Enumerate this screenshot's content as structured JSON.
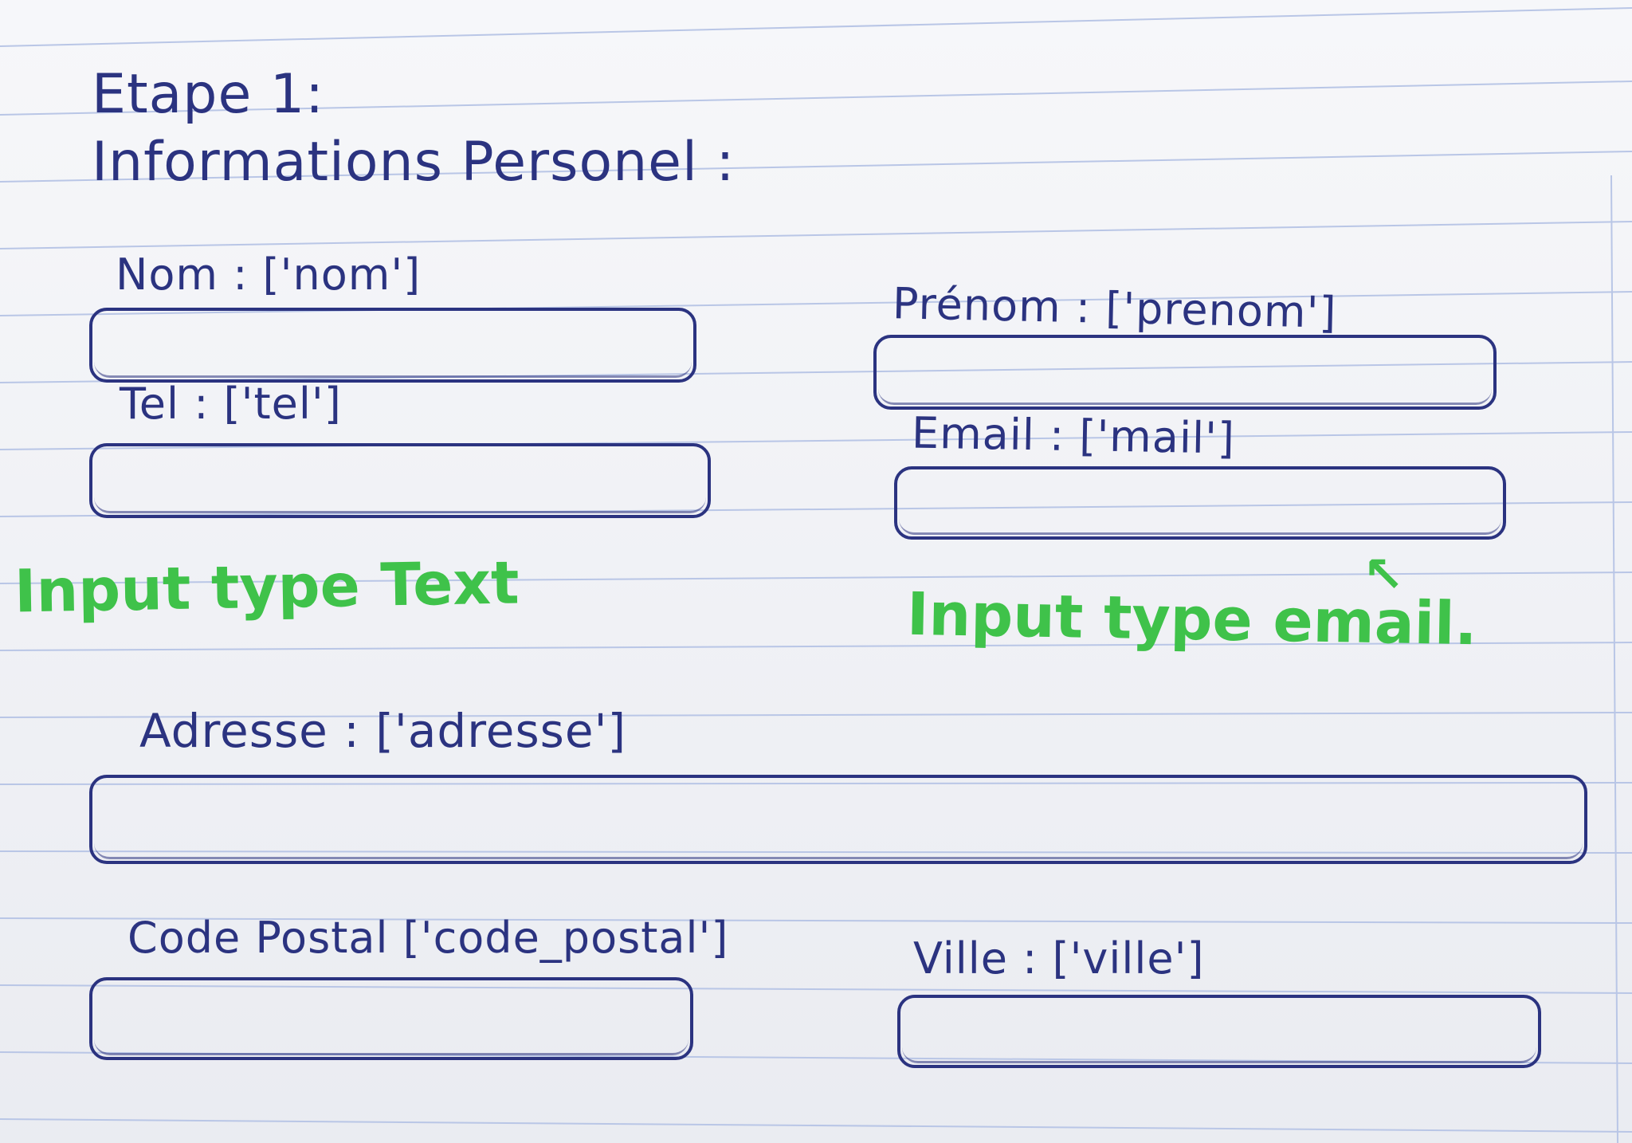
{
  "step": {
    "title": "Etape 1:",
    "section": "Informations Personel :"
  },
  "form": {
    "fields": [
      {
        "id": "nom",
        "label": "Nom : ['nom']"
      },
      {
        "id": "prenom",
        "label": "Prénom : ['prenom']"
      },
      {
        "id": "tel",
        "label": "Tel : ['tel']"
      },
      {
        "id": "email",
        "label": "Email : ['mail']"
      },
      {
        "id": "adresse",
        "label": "Adresse : ['adresse']"
      },
      {
        "id": "code_postal",
        "label": "Code Postal ['code_postal']"
      },
      {
        "id": "ville",
        "label": "Ville : ['ville']"
      }
    ]
  },
  "annotations": {
    "text_input": "Input type Text",
    "email_input": "Input type email.",
    "arrow": "↖"
  },
  "colors": {
    "ink": "#2b3380",
    "annotation": "#3fc24a",
    "paper": "#f2f3f7",
    "rules": "#b9c6e6"
  }
}
